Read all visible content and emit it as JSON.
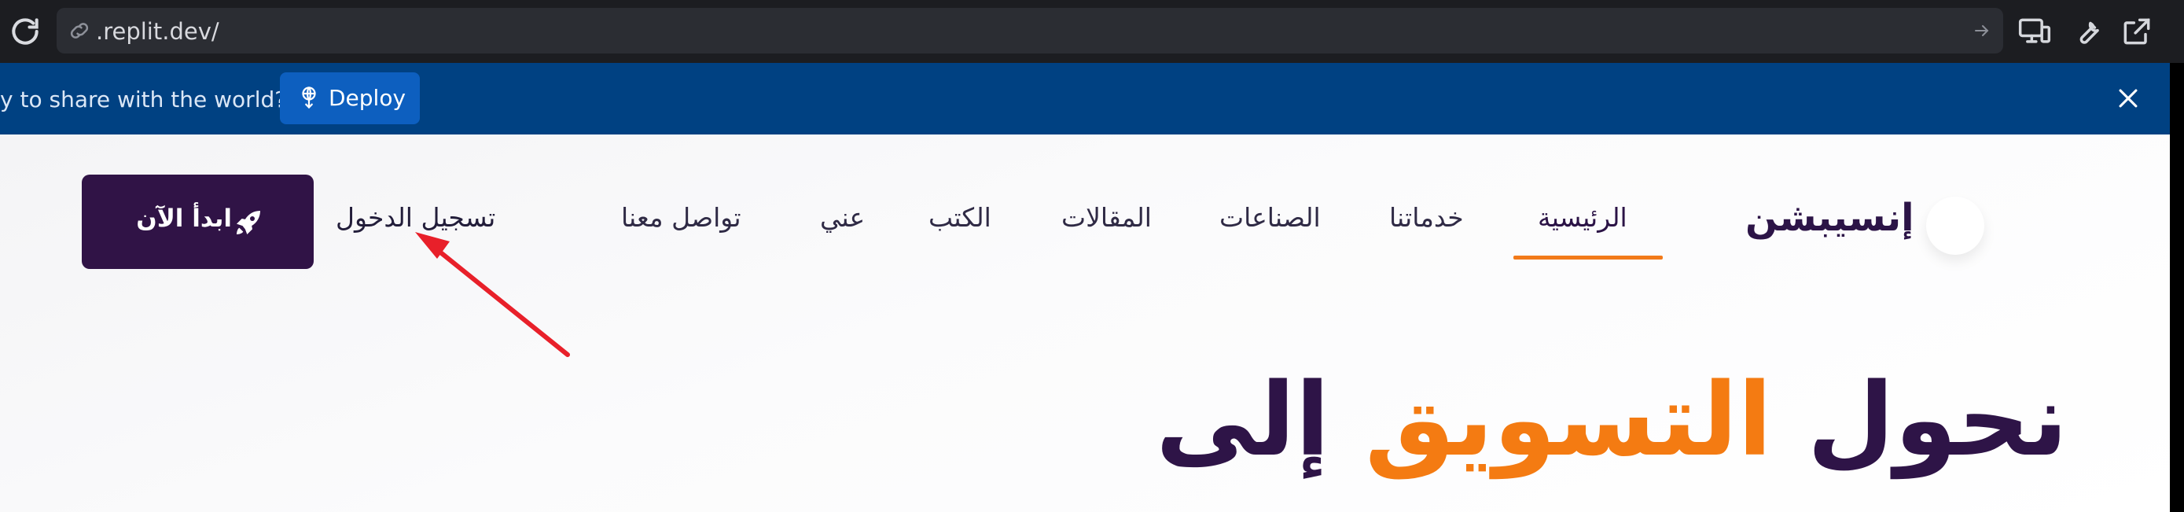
{
  "browser": {
    "url": ".replit.dev/",
    "icons": [
      "reload-icon",
      "link-icon",
      "go-arrow-icon",
      "device-preview-icon",
      "wrench-icon",
      "open-external-icon"
    ]
  },
  "banner": {
    "text": "y to share with the world?",
    "deploy_label": "Deploy",
    "close_icon": "close-icon",
    "background": "#004182"
  },
  "site": {
    "brand": "إنسيبشن",
    "nav": [
      "الرئيسية",
      "خدماتنا",
      "الصناعات",
      "المقالات",
      "الكتب",
      "عني",
      "تواصل معنا"
    ],
    "active_nav": "الرئيسية",
    "login": "تسجيل الدخول",
    "cta": "ابدأ الآن",
    "hero": {
      "part1": "نحول",
      "part2": "التسويق",
      "part3": "إلى"
    },
    "colors": {
      "primary": "#301346",
      "accent": "#f47b12"
    }
  },
  "annotation": {
    "type": "red-arrow",
    "color": "#e8202a",
    "target": "login-link"
  }
}
